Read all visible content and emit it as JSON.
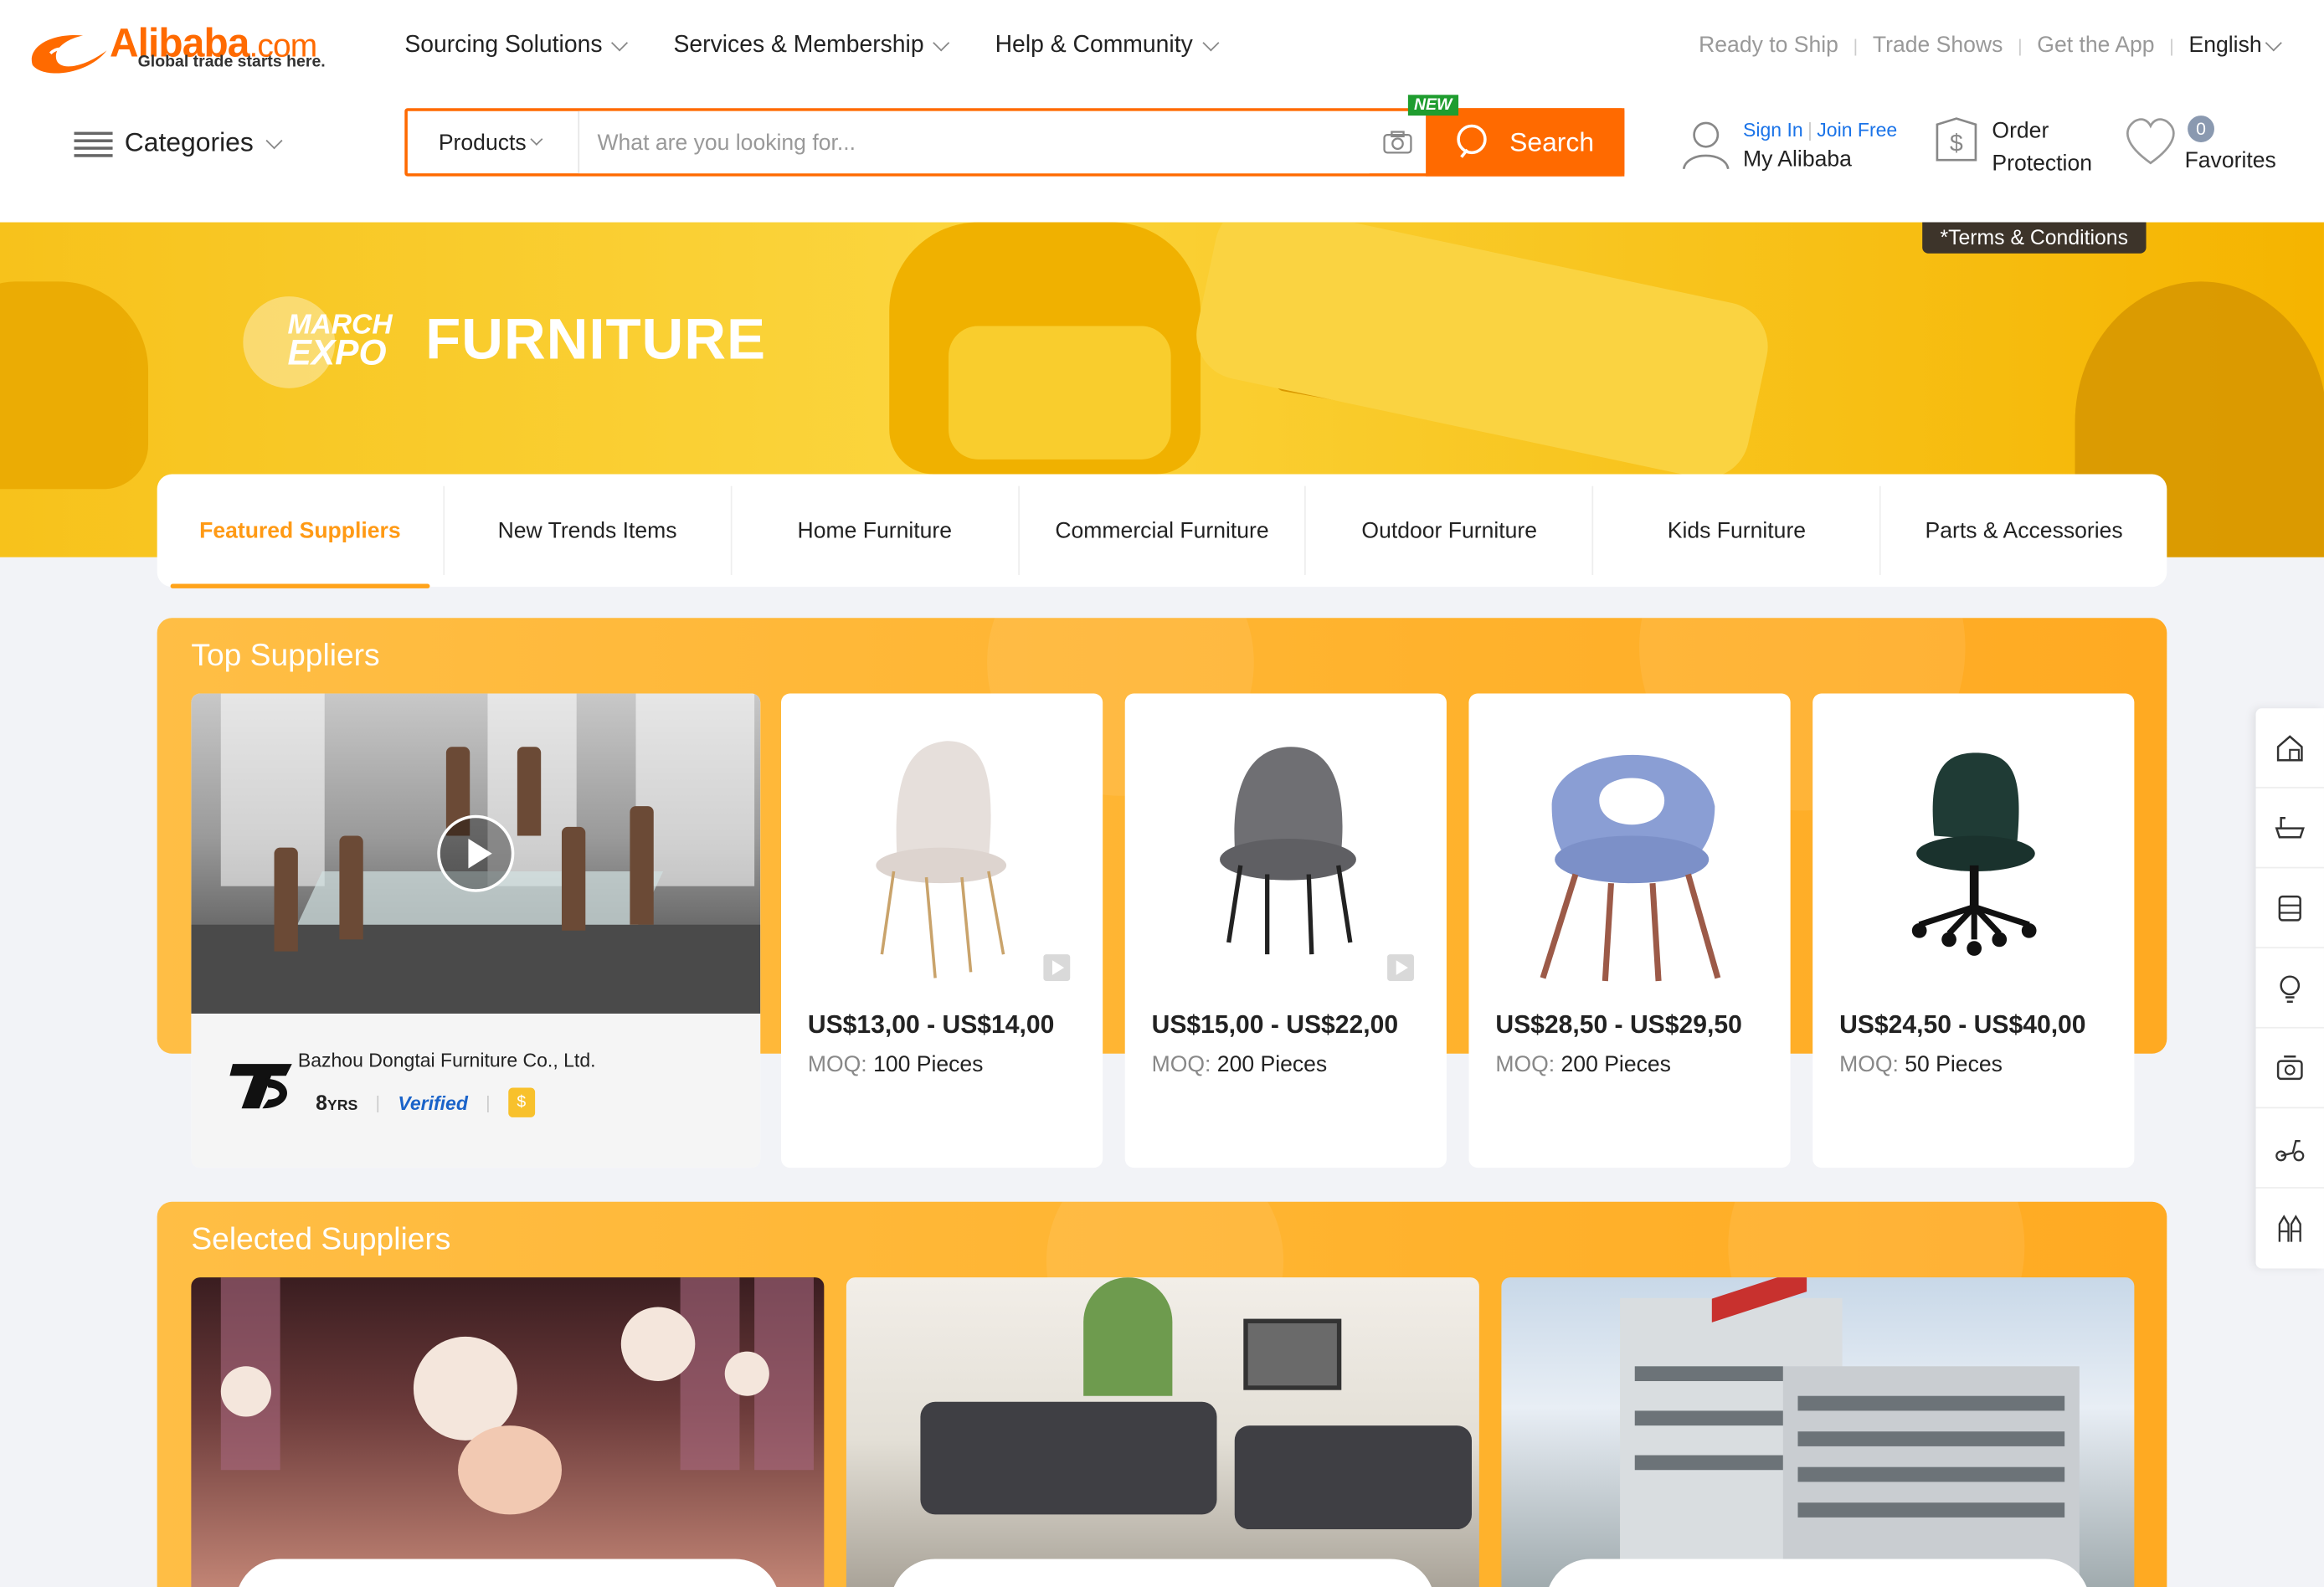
{
  "header": {
    "logo_name": "Alibaba",
    "logo_domain": ".com",
    "logo_tagline": "Global trade starts here.",
    "nav": [
      {
        "label": "Sourcing Solutions"
      },
      {
        "label": "Services & Membership"
      },
      {
        "label": "Help & Community"
      }
    ],
    "top_links": [
      "Ready to Ship",
      "Trade Shows",
      "Get the App"
    ],
    "language": "English",
    "categories_label": "Categories",
    "search": {
      "type": "Products",
      "placeholder": "What are you looking for...",
      "button": "Search",
      "badge": "NEW"
    },
    "user": {
      "sign_in": "Sign In",
      "join": "Join Free",
      "account": "My Alibaba"
    },
    "order_protection": [
      "Order",
      "Protection"
    ],
    "favorites": {
      "label": "Favorites",
      "count": "0"
    }
  },
  "banner": {
    "expo_top": "MARCH",
    "expo_bottom": "EXPO",
    "title": "FURNITURE",
    "terms": "*Terms & Conditions"
  },
  "tabs": [
    {
      "label": "Featured Suppliers",
      "active": true
    },
    {
      "label": "New Trends Items"
    },
    {
      "label": "Home Furniture"
    },
    {
      "label": "Commercial Furniture"
    },
    {
      "label": "Outdoor Furniture"
    },
    {
      "label": "Kids Furniture"
    },
    {
      "label": "Parts & Accessories"
    }
  ],
  "top_suppliers": {
    "title": "Top Suppliers",
    "supplier": {
      "name": "Bazhou Dongtai Furniture Co., Ltd.",
      "years": "8",
      "years_unit": "YRS",
      "verified": "Verified"
    },
    "moq_label": "MOQ:",
    "products": [
      {
        "price": "US$13,00 - US$14,00",
        "moq": "100 Pieces",
        "video": true,
        "color": "#e6dfdb",
        "leg": "#c9a36b"
      },
      {
        "price": "US$15,00 - US$22,00",
        "moq": "200 Pieces",
        "video": true,
        "color": "#6f6f73",
        "leg": "#222222"
      },
      {
        "price": "US$28,50 - US$29,50",
        "moq": "200 Pieces",
        "video": false,
        "color": "#8a9ed4",
        "leg": "#9c5a48"
      },
      {
        "price": "US$24,50 - US$40,00",
        "moq": "50 Pieces",
        "video": false,
        "color": "#1f3b35",
        "leg": "#111111"
      }
    ]
  },
  "selected_suppliers": {
    "title": "Selected Suppliers"
  },
  "sidebar_icons": [
    "home-furniture-icon",
    "bathtub-icon",
    "cabinet-icon",
    "lightbulb-icon",
    "kitchen-icon",
    "scooter-icon",
    "tools-icon"
  ]
}
